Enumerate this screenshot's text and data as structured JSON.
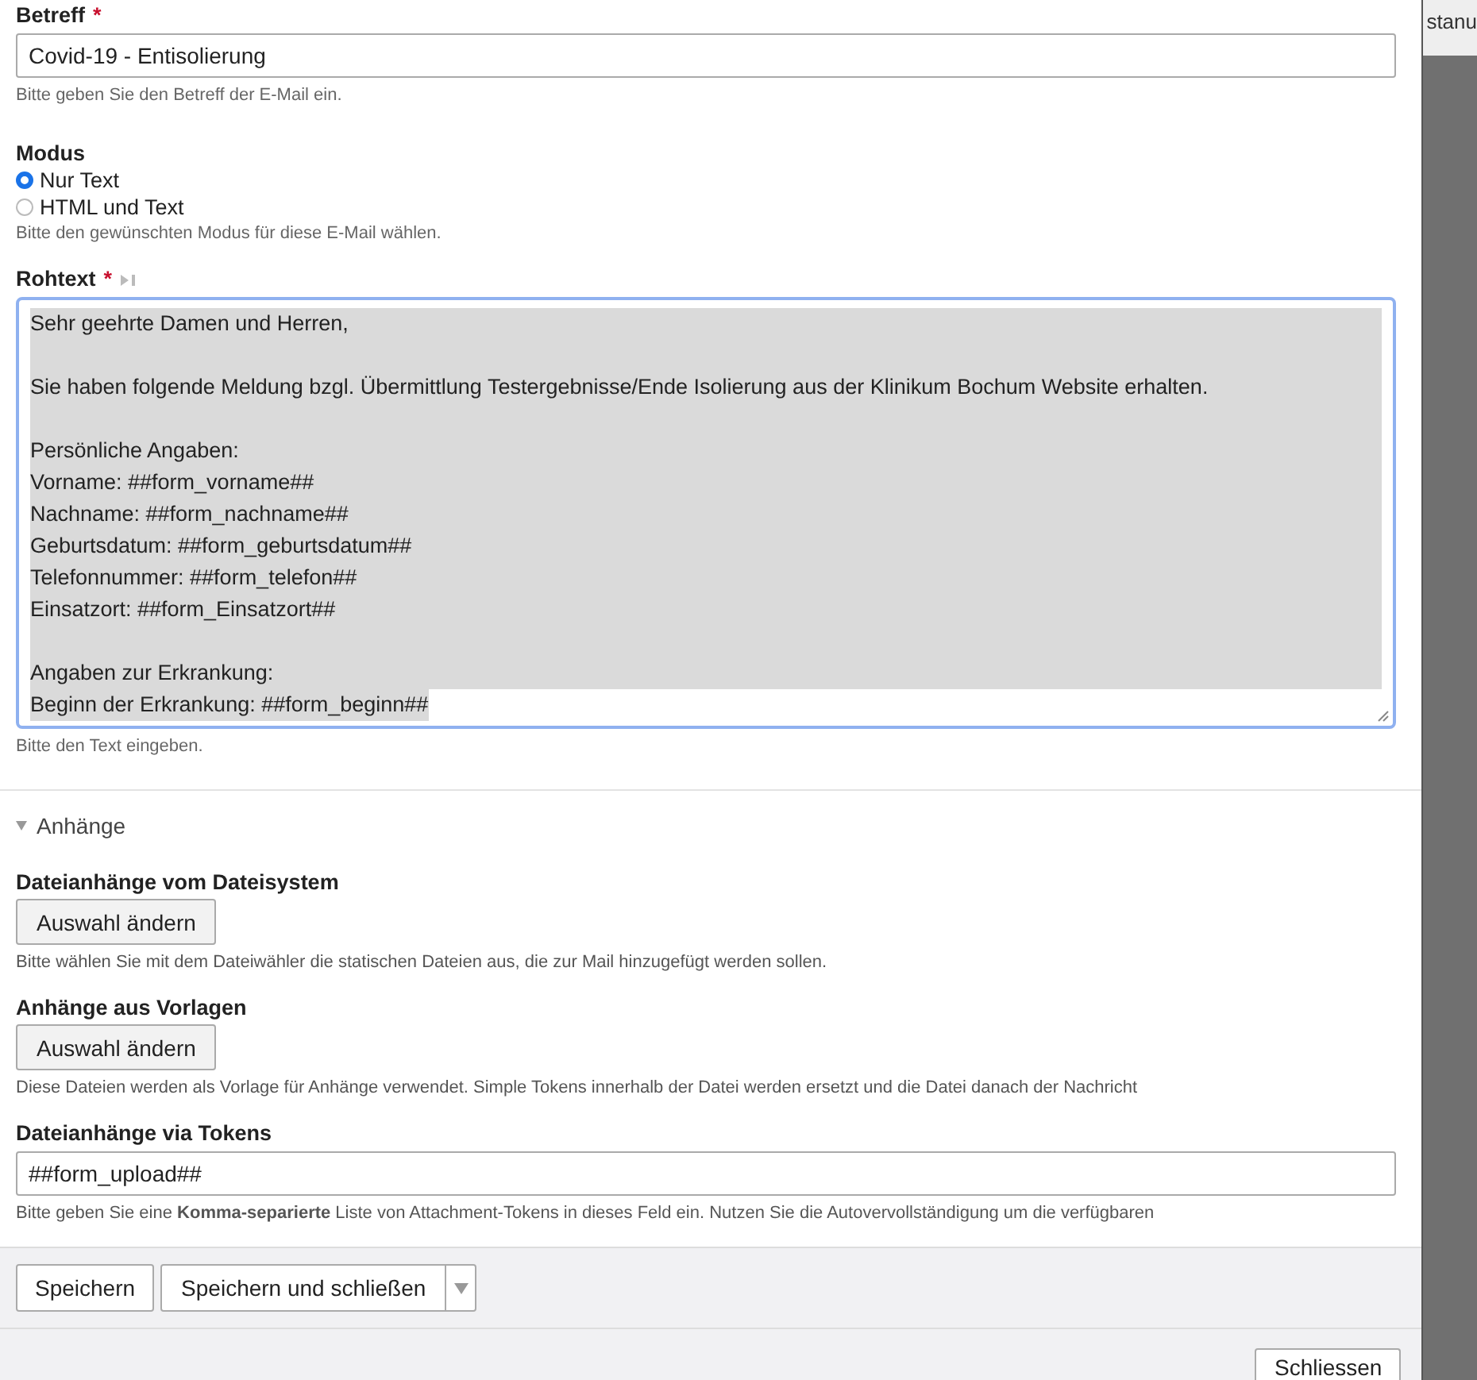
{
  "subject": {
    "label": "Betreff",
    "required": true,
    "value": "Covid-19 - Entisolierung",
    "help": "Bitte geben Sie den Betreff der E-Mail ein."
  },
  "mode": {
    "label": "Modus",
    "options": [
      {
        "label": "Nur Text",
        "selected": true
      },
      {
        "label": "HTML und Text",
        "selected": false
      }
    ],
    "help": "Bitte den gewünschten Modus für diese E-Mail wählen."
  },
  "raw_text": {
    "label": "Rohtext",
    "required": true,
    "selected": true,
    "paragraphs": [
      [
        "Sehr geehrte Damen und Herren,"
      ],
      [
        "Sie haben folgende Meldung bzgl. Übermittlung Testergebnisse/Ende Isolierung aus der Klinikum Bochum Website erhalten."
      ],
      [
        "Persönliche Angaben:",
        "Vorname: ##form_vorname##",
        "Nachname: ##form_nachname##",
        "Geburtsdatum: ##form_geburtsdatum##",
        "Telefonnummer: ##form_telefon##",
        "Einsatzort: ##form_Einsatzort##"
      ],
      [
        "Angaben zur Erkrankung:",
        "Beginn der Erkrankung: ##form_beginn##"
      ]
    ],
    "help": "Bitte den Text eingeben."
  },
  "attachments": {
    "title": "Anhänge",
    "expanded": true,
    "fields": [
      {
        "kind": "button",
        "label": "Dateianhänge vom Dateisystem",
        "button": "Auswahl ändern",
        "help": "Bitte wählen Sie mit dem Dateiwähler die statischen Dateien aus, die zur Mail hinzugefügt werden sollen."
      },
      {
        "kind": "button",
        "label": "Anhänge aus Vorlagen",
        "button": "Auswahl ändern",
        "help": "Diese Dateien werden als Vorlage für Anhänge verwendet. Simple Tokens innerhalb der Datei werden ersetzt und die Datei danach der Nachricht"
      },
      {
        "kind": "input",
        "label": "Dateianhänge via Tokens",
        "value": "##form_upload##",
        "help": "Bitte geben Sie eine **Komma-separierte** Liste von Attachment-Tokens in dieses Feld ein. Nutzen Sie die Autovervollständigung um die verfügbaren"
      }
    ]
  },
  "actions": {
    "save": "Speichern",
    "save_close": "Speichern und schließen"
  },
  "close_button": "Schliessen",
  "backdrop": {
    "text": "stanu"
  },
  "required_mark": "*"
}
